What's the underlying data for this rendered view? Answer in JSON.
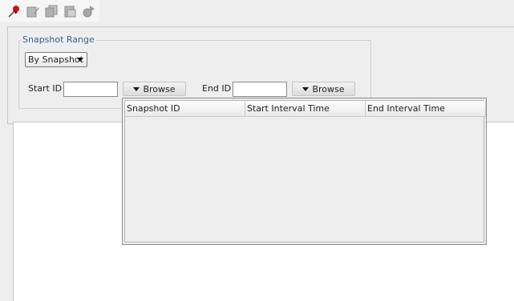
{
  "toolbar": {
    "icons": [
      "pin-icon",
      "edit-icon",
      "copy-icon",
      "paste-icon",
      "export-icon"
    ]
  },
  "snapshot_range": {
    "title": "Snapshot Range",
    "mode_selected": "By Snapshot",
    "start_label": "Start ID",
    "start_value": "",
    "end_label": "End ID",
    "end_value": "",
    "browse_label": "Browse"
  },
  "popup_table": {
    "columns": [
      "Snapshot ID",
      "Start Interval Time",
      "End Interval Time"
    ],
    "rows": []
  },
  "colors": {
    "accent_title": "#3a5f8c",
    "pin_red": "#cc1111"
  }
}
